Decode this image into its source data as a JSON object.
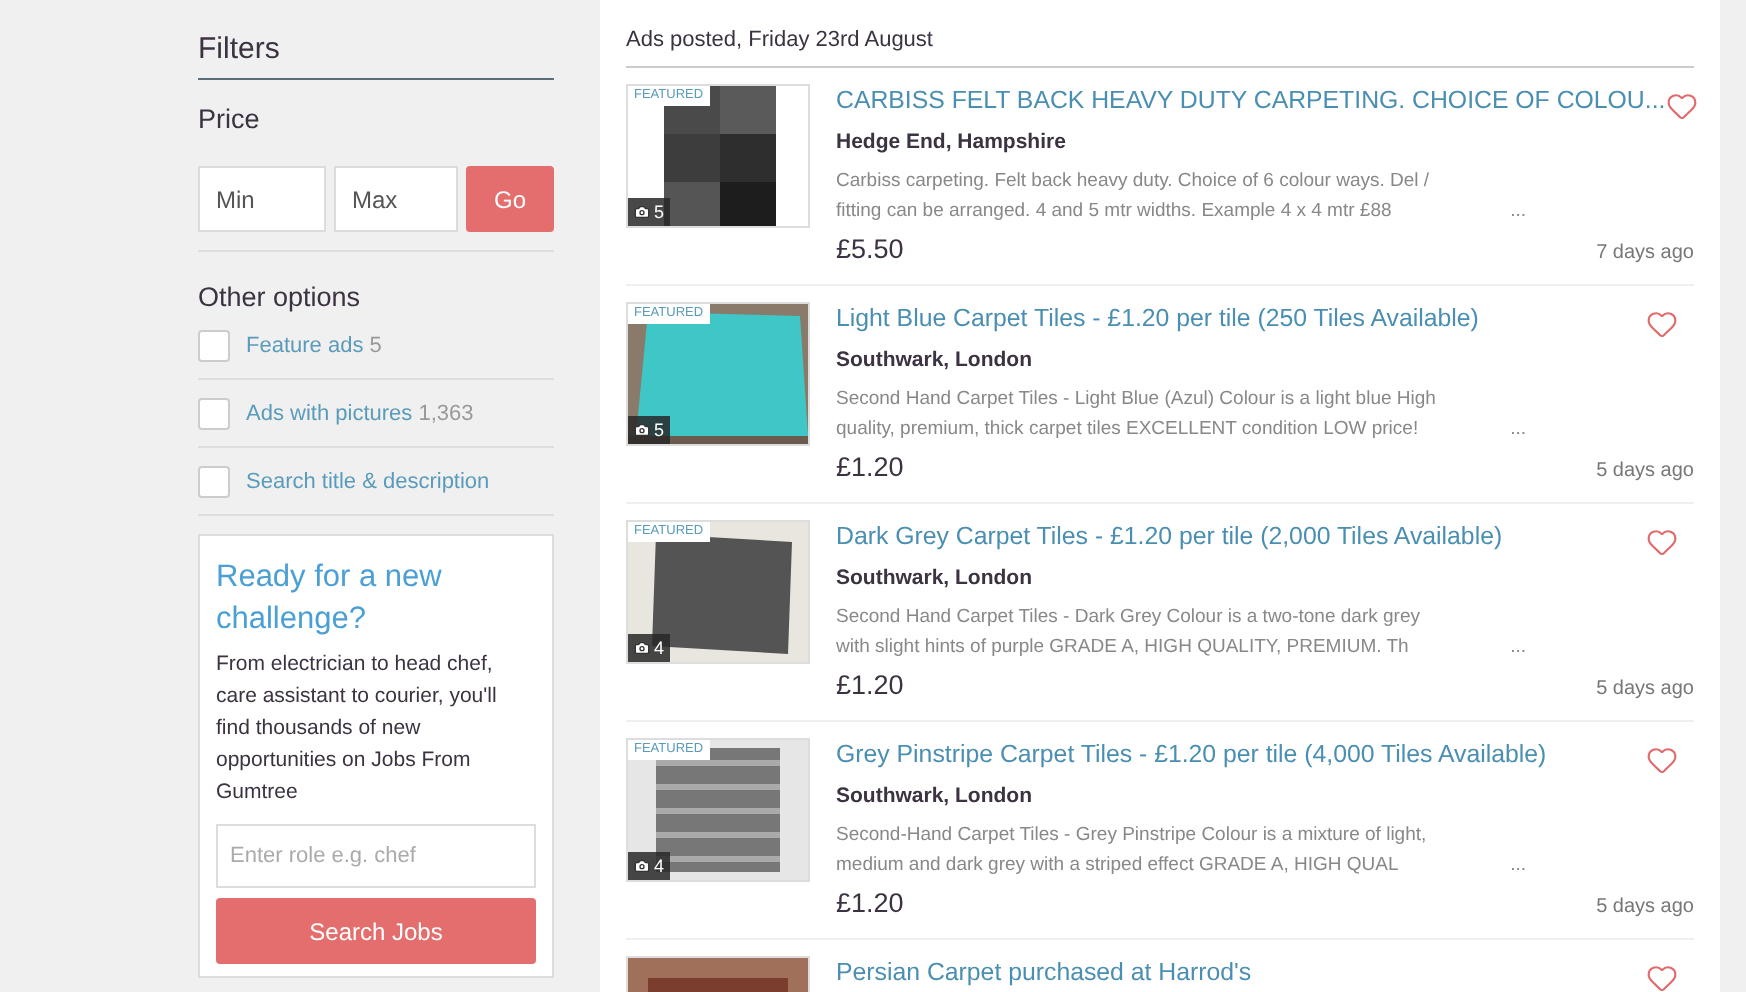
{
  "filters": {
    "title": "Filters",
    "price": {
      "label": "Price",
      "min_placeholder": "Min",
      "max_placeholder": "Max",
      "button": "Go"
    },
    "other_options": {
      "title": "Other options",
      "items": [
        {
          "label": "Feature ads",
          "count": "5",
          "checked": false
        },
        {
          "label": "Ads with pictures",
          "count": "1,363",
          "checked": false
        },
        {
          "label": "Search title & description",
          "checked": false
        }
      ]
    }
  },
  "jobs_card": {
    "title": "Ready for a new challenge?",
    "body": "From electrician to head chef, care assistant to courier, you'll find thousands of new opportunities on Jobs From Gumtree",
    "placeholder": "Enter role e.g. chef",
    "button": "Search Jobs"
  },
  "listings": {
    "heading": "Ads posted, Friday 23rd August",
    "ads": [
      {
        "title": "CARBISS FELT BACK HEAVY DUTY CARPETING. CHOICE OF COLOU...",
        "location": "Hedge End, Hampshire",
        "desc": [
          "Carbiss carpeting. Felt back heavy duty. Choice of 6 colour ways. Del /",
          "fitting can be arranged. 4 and 5 mtr widths. Example 4 x 4 mtr £88"
        ],
        "more": "...",
        "price": "£5.50",
        "age": "7 days ago",
        "badge": "FEATURED",
        "photos": "5"
      },
      {
        "title": "Light Blue Carpet Tiles - £1.20 per tile (250 Tiles Available)",
        "location": "Southwark, London",
        "desc": [
          "Second Hand Carpet Tiles - Light Blue (Azul) Colour is a light blue High",
          "quality, premium, thick carpet tiles EXCELLENT condition LOW price!"
        ],
        "more": "...",
        "price": "£1.20",
        "age": "5 days ago",
        "badge": "FEATURED",
        "photos": "5"
      },
      {
        "title": "Dark Grey Carpet Tiles - £1.20 per tile (2,000 Tiles Available)",
        "location": "Southwark, London",
        "desc": [
          "Second Hand Carpet Tiles - Dark Grey Colour is a two-tone dark grey",
          "with slight hints of purple GRADE A, HIGH QUALITY, PREMIUM. Th"
        ],
        "more": "...",
        "price": "£1.20",
        "age": "5 days ago",
        "badge": "FEATURED",
        "photos": "4"
      },
      {
        "title": "Grey Pinstripe Carpet Tiles - £1.20 per tile (4,000 Tiles Available)",
        "location": "Southwark, London",
        "desc": [
          "Second-Hand Carpet Tiles - Grey Pinstripe Colour is a mixture of light,",
          "medium and dark grey with a striped effect GRADE A, HIGH QUAL"
        ],
        "more": "...",
        "price": "£1.20",
        "age": "5 days ago",
        "badge": "FEATURED",
        "photos": "4"
      },
      {
        "title": "Persian Carpet purchased at Harrod's"
      }
    ]
  }
}
